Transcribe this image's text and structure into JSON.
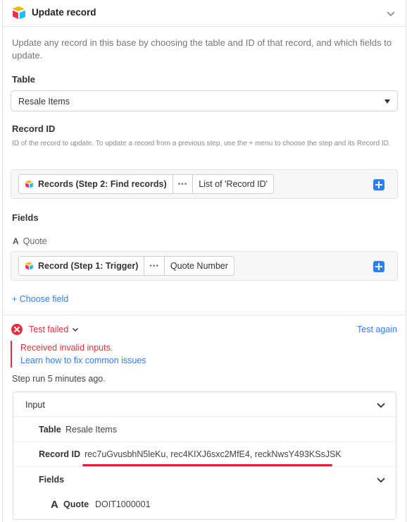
{
  "header": {
    "title": "Update record",
    "description": "Update any record in this base by choosing the table and ID of that record, and which fields to update."
  },
  "table": {
    "label": "Table",
    "selected": "Resale Items"
  },
  "record_id": {
    "label": "Record ID",
    "help": "ID of the record to update. To update a record from a previous step, use the + menu to choose the step and its Record ID.",
    "token": {
      "source": "Records (Step 2: Find records)",
      "dots": "•••",
      "field": "List of 'Record ID'"
    }
  },
  "fields": {
    "label": "Fields",
    "items": [
      {
        "type_icon": "A",
        "name": "Quote",
        "token": {
          "source": "Record (Step 1: Trigger)",
          "dots": "•••",
          "field": "Quote Number"
        }
      }
    ],
    "choose_field": "+ Choose field"
  },
  "test": {
    "status": "Test failed",
    "again": "Test again",
    "error": "Received invalid inputs.",
    "help_link": "Learn how to fix common issues",
    "step_run": "Step run 5 minutes ago."
  },
  "input": {
    "title": "Input",
    "table_label": "Table",
    "table_value": "Resale Items",
    "record_label": "Record ID",
    "record_value": "rec7uGvusbhN5leKu, rec4KIXJ6sxc2MfE4, reckNwsY493KSsJSK",
    "fields_label": "Fields",
    "field_icon": "A",
    "field_name": "Quote",
    "field_value": "DOIT1000001"
  },
  "colors": {
    "error": "#e0303b",
    "link": "#2d7ff9",
    "highlight_underline": "#e02030"
  }
}
